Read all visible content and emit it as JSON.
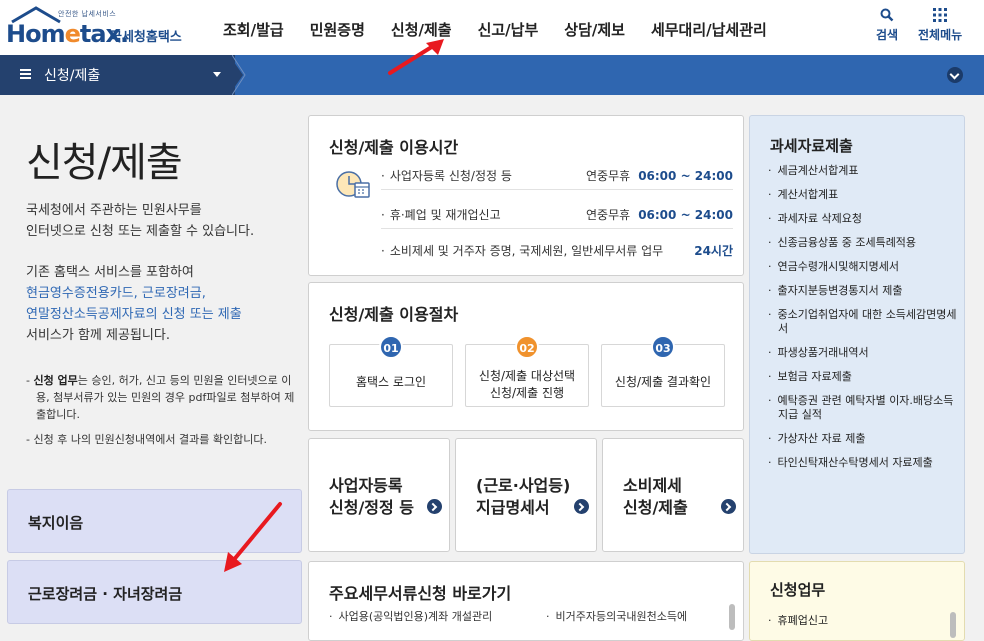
{
  "logo": {
    "tagline": "안전한 납세서비스",
    "brand_a": "Hom",
    "brand_e": "e",
    "brand_b": "tax.",
    "korean": "국세청홈택스"
  },
  "gnb": [
    "조회/발급",
    "민원증명",
    "신청/제출",
    "신고/납부",
    "상담/제보",
    "세무대리/납세관리"
  ],
  "util": {
    "search": "검색",
    "menu": "전체메뉴"
  },
  "navbar": {
    "current": "신청/제출"
  },
  "left": {
    "title": "신청/제출",
    "desc1": [
      "국세청에서 주관하는 민원사무를",
      "인터넷으로 신청 또는 제출할 수 있습니다."
    ],
    "desc2_plain1": "기존 홈택스 서비스를 포함하여",
    "desc2_blue": [
      "현금영수증전용카드, 근로장려금,",
      "연말정산소득공제자료의 신청 또는 제출"
    ],
    "desc2_plain2": "서비스가 함께 제공됩니다.",
    "note1_bold": "신청 업무",
    "note1_rest": "는 승인, 허가, 신고 등의 민원을 인터넷으로 이용, 첨부서류가 있는 민원의 경우 pdf파일로 첨부하여 제출합니다.",
    "note2": "신청 후 나의 민원신청내역에서 결과를 확인합니다.",
    "box1": "복지이음",
    "box2": "근로장려금 · 자녀장려금"
  },
  "hours": {
    "title": "신청/제출 이용시간",
    "rows": [
      {
        "label": "사업자등록 신청/정정 등",
        "prefix": "연중무휴",
        "time": "06:00 ~ 24:00"
      },
      {
        "label": "휴·폐업 및 재개업신고",
        "prefix": "연중무휴",
        "time": "06:00 ~ 24:00"
      },
      {
        "label": "소비제세 및 거주자 증명, 국제세원, 일반세무서류 업무",
        "prefix": "",
        "time": "24시간"
      }
    ]
  },
  "process": {
    "title": "신청/제출 이용절차",
    "steps": [
      {
        "num": "01",
        "lines": [
          "홈택스 로그인"
        ]
      },
      {
        "num": "02",
        "lines": [
          "신청/제출 대상선택",
          "신청/제출 진행"
        ]
      },
      {
        "num": "03",
        "lines": [
          "신청/제출 결과확인"
        ]
      }
    ]
  },
  "services": [
    {
      "lines": [
        "사업자등록",
        "신청/정정 등"
      ]
    },
    {
      "lines": [
        "(근로·사업등)",
        "지급명세서"
      ]
    },
    {
      "lines": [
        "소비제세",
        "신청/제출"
      ]
    }
  ],
  "quick": {
    "title": "주요세무서류신청 바로가기",
    "items": [
      "사업용(공익법인용)계좌 개설관리",
      "비거주자등의국내원천소득에"
    ]
  },
  "right": {
    "title": "과세자료제출",
    "items": [
      "세금계산서합계표",
      "계산서합계표",
      "과세자료 삭제요청",
      "신종금융상품 중 조세특례적용",
      "연금수령개시및해지명세서",
      "출자지분등변경통지서 제출",
      "중소기업취업자에 대한 소득세감면명세서",
      "파생상품거래내역서",
      "보험금 자료제출",
      "예탁증권 관련 예탁자별 이자.배당소득 지급 실적",
      "가상자산 자료 제출",
      "타인신탁재산수탁명세서 자료제출"
    ]
  },
  "right2": {
    "title": "신청업무",
    "item": "휴폐업신고"
  }
}
